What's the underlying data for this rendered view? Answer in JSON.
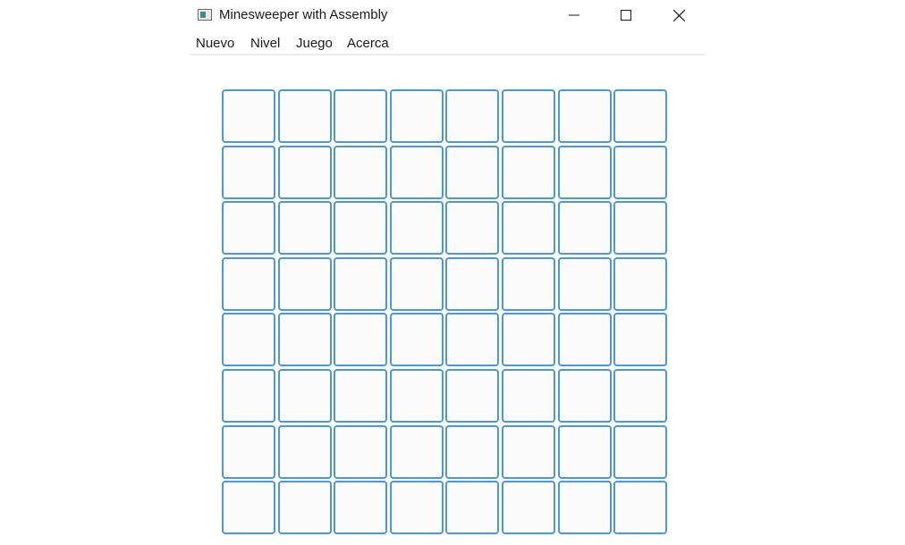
{
  "window": {
    "title": "Minesweeper with Assembly"
  },
  "menu": {
    "items": [
      "Nuevo",
      "Nivel",
      "Juego",
      "Acerca"
    ]
  },
  "board": {
    "rows": 8,
    "cols": 8,
    "cell_state": "unrevealed"
  },
  "colors": {
    "cell_border": "#4a98d8",
    "cell_fill": "#fbfbfb",
    "icon_teal": "#3e8f8a"
  },
  "icons": {
    "app": "minesweeper-app-icon",
    "minimize": "minimize-icon",
    "maximize": "maximize-icon",
    "close": "close-icon"
  }
}
